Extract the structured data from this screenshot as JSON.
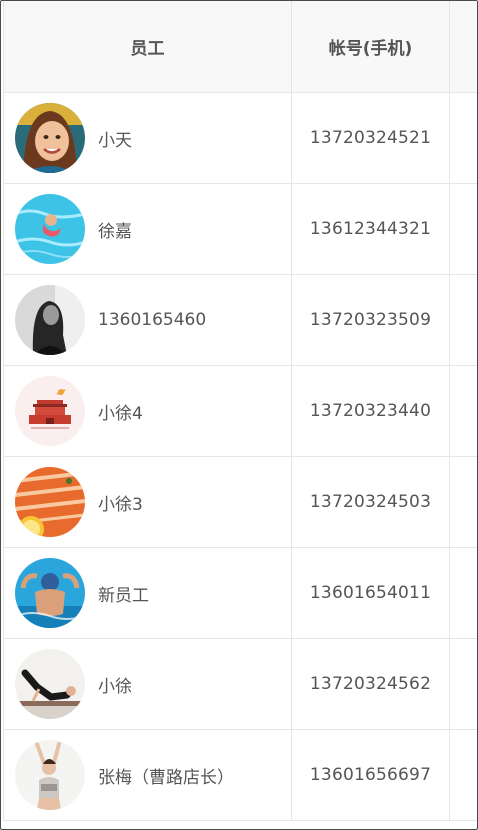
{
  "table": {
    "headers": {
      "employee": "员工",
      "account": "帐号(手机)"
    },
    "rows": [
      {
        "name": "小天",
        "account": "13720324521",
        "avatar": "child-photo-avatar"
      },
      {
        "name": "徐嘉",
        "account": "13612344321",
        "avatar": "swimming-pool-avatar"
      },
      {
        "name": "1360165460",
        "account": "13720323509",
        "avatar": "grayscale-portrait-avatar"
      },
      {
        "name": "小徐4",
        "account": "13720323440",
        "avatar": "tiananmen-illustration-avatar"
      },
      {
        "name": "小徐3",
        "account": "13720324503",
        "avatar": "salmon-food-avatar"
      },
      {
        "name": "新员工",
        "account": "13601654011",
        "avatar": "swimmer-avatar"
      },
      {
        "name": "小徐",
        "account": "13720324562",
        "avatar": "yoga-pose-avatar"
      },
      {
        "name": "张梅（曹路店长）",
        "account": "13601656697",
        "avatar": "dancer-avatar"
      }
    ]
  }
}
